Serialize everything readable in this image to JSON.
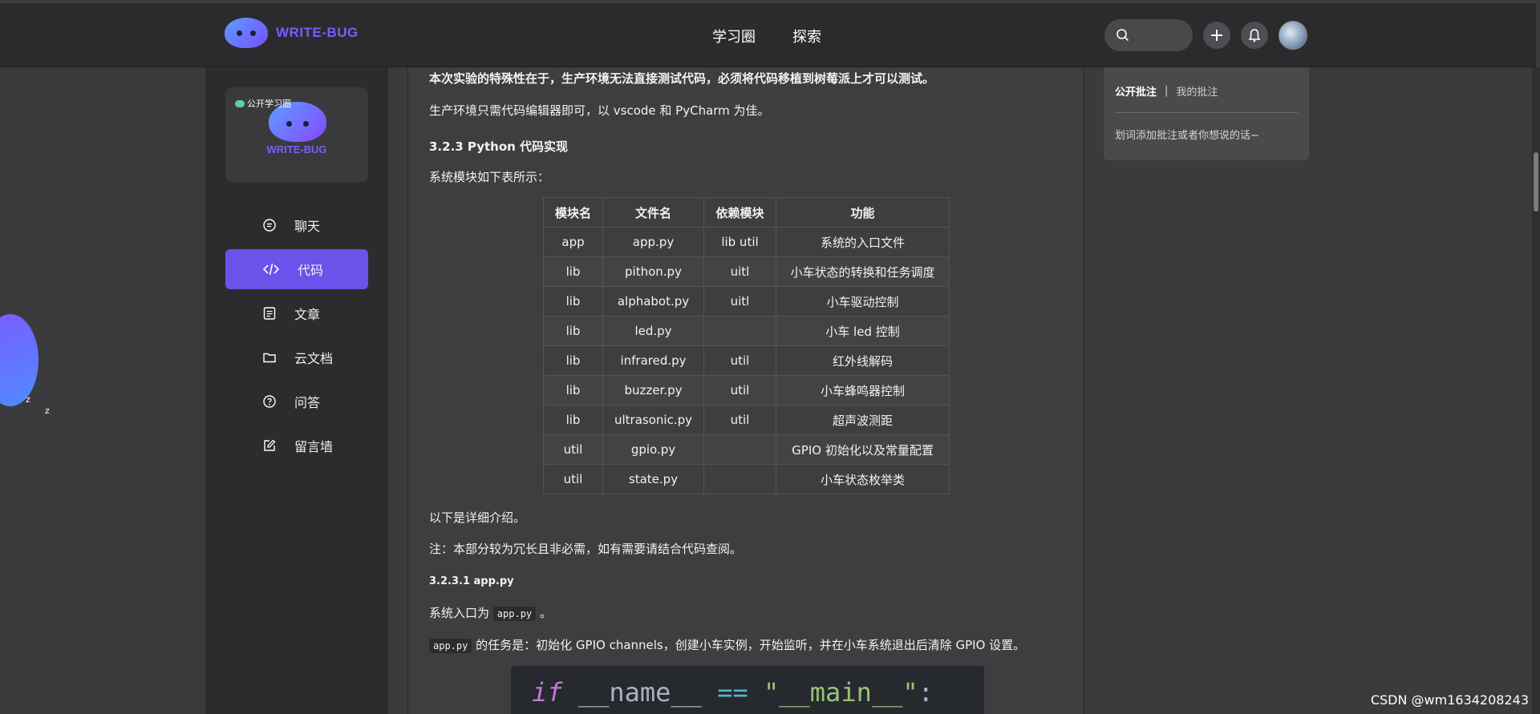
{
  "header": {
    "brand": "WRITE-BUG",
    "nav": [
      "学习圈",
      "探索"
    ]
  },
  "circle_card": {
    "badge": "公开学习圈",
    "name": "WRITE-BUG"
  },
  "sidebar": {
    "items": [
      {
        "label": "聊天",
        "icon": "chat-icon"
      },
      {
        "label": "代码",
        "icon": "code-icon",
        "active": true
      },
      {
        "label": "文章",
        "icon": "article-icon"
      },
      {
        "label": "云文档",
        "icon": "folder-icon"
      },
      {
        "label": "问答",
        "icon": "question-icon"
      },
      {
        "label": "留言墙",
        "icon": "edit-icon"
      }
    ]
  },
  "article": {
    "p1": "本次实验的特殊性在于，生产环境无法直接测试代码，必须将代码移植到树莓派上才可以测试。",
    "p2": "生产环境只需代码编辑器即可，以 vscode 和 PyCharm 为佳。",
    "h_impl": "3.2.3 Python 代码实现",
    "p_modules": "系统模块如下表所示：",
    "table": {
      "headers": [
        "模块名",
        "文件名",
        "依赖模块",
        "功能"
      ],
      "rows": [
        [
          "app",
          "app.py",
          "lib util",
          "系统的入口文件"
        ],
        [
          "lib",
          "pithon.py",
          "uitl",
          "小车状态的转换和任务调度"
        ],
        [
          "lib",
          "alphabot.py",
          "uitl",
          "小车驱动控制"
        ],
        [
          "lib",
          "led.py",
          "",
          "小车 led 控制"
        ],
        [
          "lib",
          "infrared.py",
          "util",
          "红外线解码"
        ],
        [
          "lib",
          "buzzer.py",
          "util",
          "小车蜂鸣器控制"
        ],
        [
          "lib",
          "ultrasonic.py",
          "util",
          "超声波测距"
        ],
        [
          "util",
          "gpio.py",
          "",
          "GPIO 初始化以及常量配置"
        ],
        [
          "util",
          "state.py",
          "",
          "小车状态枚举类"
        ]
      ]
    },
    "p_detail": "以下是详细介绍。",
    "p_note": "注：本部分较为冗长且非必需，如有需要请结合代码查阅。",
    "h_app": "3.2.3.1 app.py",
    "p_entry_prefix": "系统入口为",
    "p_entry_code": "app.py",
    "p_entry_suffix": "。",
    "p_task_code": "app.py",
    "p_task_text": "的任务是：初始化 GPIO channels，创建小车实例，开始监听，并在小车系统退出后清除 GPIO 设置。",
    "code": {
      "kw": "if",
      "name": "__name__",
      "op": "==",
      "str": "\"__main__\"",
      "colon": ":"
    }
  },
  "annotations": {
    "tab_public": "公开批注",
    "sep": "|",
    "tab_mine": "我的批注",
    "hint": "划词添加批注或者你想说的话~"
  },
  "floating": {
    "z1": "z",
    "z2": "z"
  },
  "watermark": "CSDN @wm1634208243"
}
